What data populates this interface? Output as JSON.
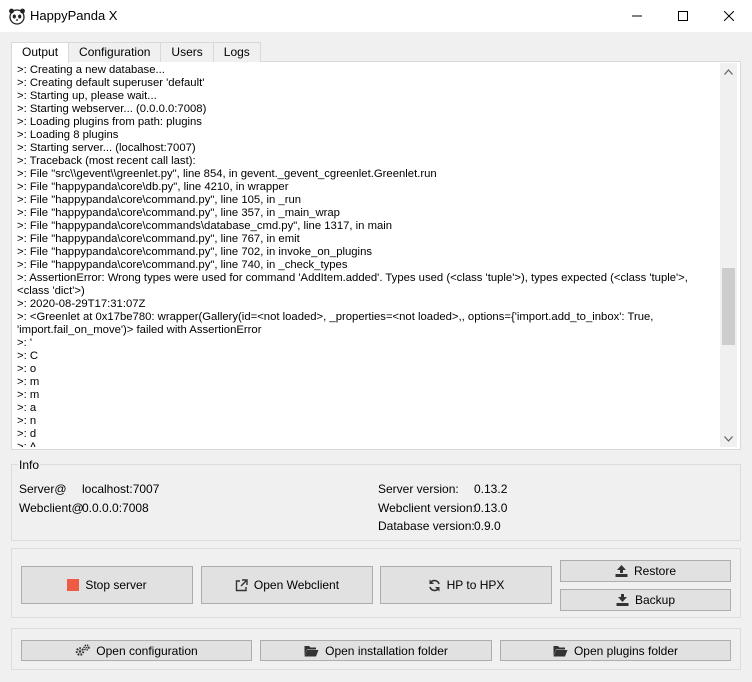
{
  "window": {
    "title": "HappyPanda X"
  },
  "tabs": [
    {
      "label": "Output",
      "active": true
    },
    {
      "label": "Configuration",
      "active": false
    },
    {
      "label": "Users",
      "active": false
    },
    {
      "label": "Logs",
      "active": false
    }
  ],
  "output": {
    "lines": [
      ">: Creating a new database...",
      ">: Creating default superuser 'default'",
      ">: Starting up, please wait...",
      ">: Starting webserver... (0.0.0.0:7008)",
      ">: Loading plugins from path: plugins",
      ">: Loading 8 plugins",
      ">: Starting server... (localhost:7007)",
      ">: Traceback (most recent call last):",
      ">: File \"src\\\\gevent\\\\greenlet.py\", line 854, in gevent._gevent_cgreenlet.Greenlet.run",
      ">: File \"happypanda\\core\\db.py\", line 4210, in wrapper",
      ">: File \"happypanda\\core\\command.py\", line 105, in _run",
      ">: File \"happypanda\\core\\command.py\", line 357, in _main_wrap",
      ">: File \"happypanda\\core\\commands\\database_cmd.py\", line 1317, in main",
      ">: File \"happypanda\\core\\command.py\", line 767, in emit",
      ">: File \"happypanda\\core\\command.py\", line 702, in invoke_on_plugins",
      ">: File \"happypanda\\core\\command.py\", line 740, in _check_types",
      ">: AssertionError: Wrong types were used for command 'AddItem.added'. Types used (<class 'tuple'>), types expected (<class 'tuple'>, <class 'dict'>)",
      ">: 2020-08-29T17:31:07Z",
      ">: <Greenlet at 0x17be780: wrapper(Gallery(id=<not loaded>, _properties=<not loaded>,, options={'import.add_to_inbox': True, 'import.fail_on_move')> failed with AssertionError",
      ">: '",
      ">: C",
      ">: o",
      ">: m",
      ">: m",
      ">: a",
      ">: n",
      ">: d",
      ">: A"
    ]
  },
  "info": {
    "title": "Info",
    "server_label": "Server@",
    "server_value": "localhost:7007",
    "webclient_label": "Webclient@",
    "webclient_value": "0.0.0.0:7008",
    "server_version_label": "Server version:",
    "server_version_value": "0.13.2",
    "webclient_version_label": "Webclient version:",
    "webclient_version_value": "0.13.0",
    "database_version_label": "Database version:",
    "database_version_value": "0.9.0"
  },
  "buttons": {
    "stop_server": "Stop server",
    "open_webclient": "Open Webclient",
    "hp_to_hpx": "HP to HPX",
    "restore": "Restore",
    "backup": "Backup",
    "open_configuration": "Open configuration",
    "open_installation_folder": "Open installation folder",
    "open_plugins_folder": "Open plugins folder"
  },
  "colors": {
    "stop_icon": "#ee5a42",
    "scroll_thumb": "#cdcdcd"
  }
}
